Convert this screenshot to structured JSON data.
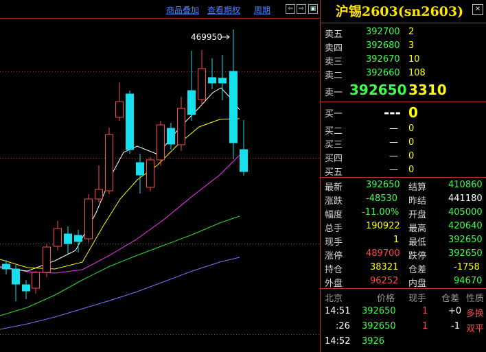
{
  "toolbar": {
    "overlay_label": "商品叠加",
    "options_label": "查看期权",
    "period_label": "周期",
    "peak_label": "469950"
  },
  "colors": {
    "up": "#ff4a4a",
    "down": "#16e0ee",
    "ma5": "#ffffff",
    "ma10": "#ffff00",
    "ma20": "#ff33ff",
    "ma40": "#33dd33",
    "ma60": "#7777ff"
  },
  "quote": {
    "title": "沪锡2603(sn2603)",
    "asks": [
      {
        "label": "卖五",
        "price": "392700",
        "vol": "2"
      },
      {
        "label": "卖四",
        "price": "392680",
        "vol": "3"
      },
      {
        "label": "卖三",
        "price": "392670",
        "vol": "10"
      },
      {
        "label": "卖二",
        "price": "392660",
        "vol": "108"
      },
      {
        "label": "卖一",
        "price": "392650",
        "vol": "3310"
      }
    ],
    "bids": [
      {
        "label": "买一",
        "price": "---",
        "vol": "0"
      },
      {
        "label": "买二",
        "price": "—",
        "vol": "0"
      },
      {
        "label": "买三",
        "price": "—",
        "vol": "0"
      },
      {
        "label": "买四",
        "price": "—",
        "vol": "0"
      },
      {
        "label": "买五",
        "price": "—",
        "vol": "0"
      }
    ],
    "stats": [
      {
        "l1": "最新",
        "v1": "392650",
        "l2": "结算",
        "v2": "410860"
      },
      {
        "l1": "涨跌",
        "v1": "-48530",
        "l2": "昨结",
        "v2": "441180"
      },
      {
        "l1": "幅度",
        "v1": "-11.00%",
        "l2": "开盘",
        "v2": "405000"
      },
      {
        "l1": "总手",
        "v1": "190922",
        "l2": "最高",
        "v2": "420640"
      },
      {
        "l1": "现手",
        "v1": "1",
        "l2": "最低",
        "v2": "392650"
      },
      {
        "l1": "涨停",
        "v1": "489700",
        "l2": "跌停",
        "v2": "392650"
      },
      {
        "l1": "持仓",
        "v1": "38321",
        "l2": "仓差",
        "v2": "-1758"
      },
      {
        "l1": "外盘",
        "v1": "96252",
        "l2": "内盘",
        "v2": "94670"
      }
    ],
    "ticks_header": {
      "c1": "北京",
      "c2": "价格",
      "c3": "现手",
      "c4": "仓差",
      "c5": "性质"
    },
    "ticks": [
      {
        "time": "14:51",
        "price": "392650",
        "vol": "1",
        "oi": "+0",
        "type": "多换"
      },
      {
        "time": ":26",
        "price": "392650",
        "vol": "1",
        "oi": "-1",
        "type": "双平"
      },
      {
        "time": "14:52",
        "price": "3926",
        "vol": "",
        "oi": "",
        "type": ""
      }
    ]
  }
}
